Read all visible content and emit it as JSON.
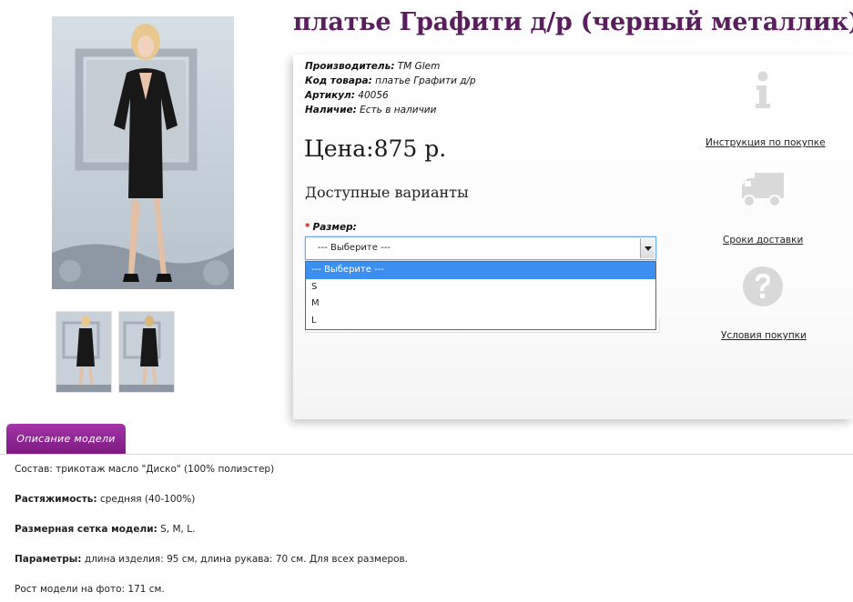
{
  "product": {
    "title": "платье Графити д/р (черный металлик)",
    "manufacturer_label": "Производитель:",
    "manufacturer": "TM Glem",
    "code_label": "Код товара:",
    "code": "платье Графити д/р",
    "article_label": "Артикул:",
    "article": "40056",
    "availability_label": "Наличие:",
    "availability": "Есть в наличии",
    "price": "Цена:875 р.",
    "variants_heading": "Доступные варианты"
  },
  "options": {
    "size_label": "Размер:",
    "required_mark": "*",
    "selected": "--- Выберите ---",
    "items": [
      "--- Выберите ---",
      "S",
      "M",
      "L"
    ]
  },
  "info": {
    "instruction": "Инструкция по покупке",
    "delivery": "Сроки доставки",
    "conditions": "Условия покупки"
  },
  "tabs": {
    "description": "Описание модели"
  },
  "description": {
    "composition_label": "Состав:",
    "composition": "трикотаж масло \"Диско\" (100% полиэстер)",
    "stretch_label": "Растяжимость:",
    "stretch": "средняя (40-100%)",
    "sizes_label": "Размерная сетка модели:",
    "sizes": "S, M, L.",
    "params_label": "Параметры:",
    "params": "длина изделия: 95 см, длина рукава: 70 см. Для всех размеров.",
    "height_label": "Рост модели на фото:",
    "height": "171 см."
  },
  "colors": {
    "title": "#5a1d5e",
    "tab": "#8e2592",
    "select_highlight": "#3b8ff0",
    "icon_grey": "#d9d9d9"
  },
  "icons": [
    "info-icon",
    "truck-icon",
    "question-icon"
  ]
}
